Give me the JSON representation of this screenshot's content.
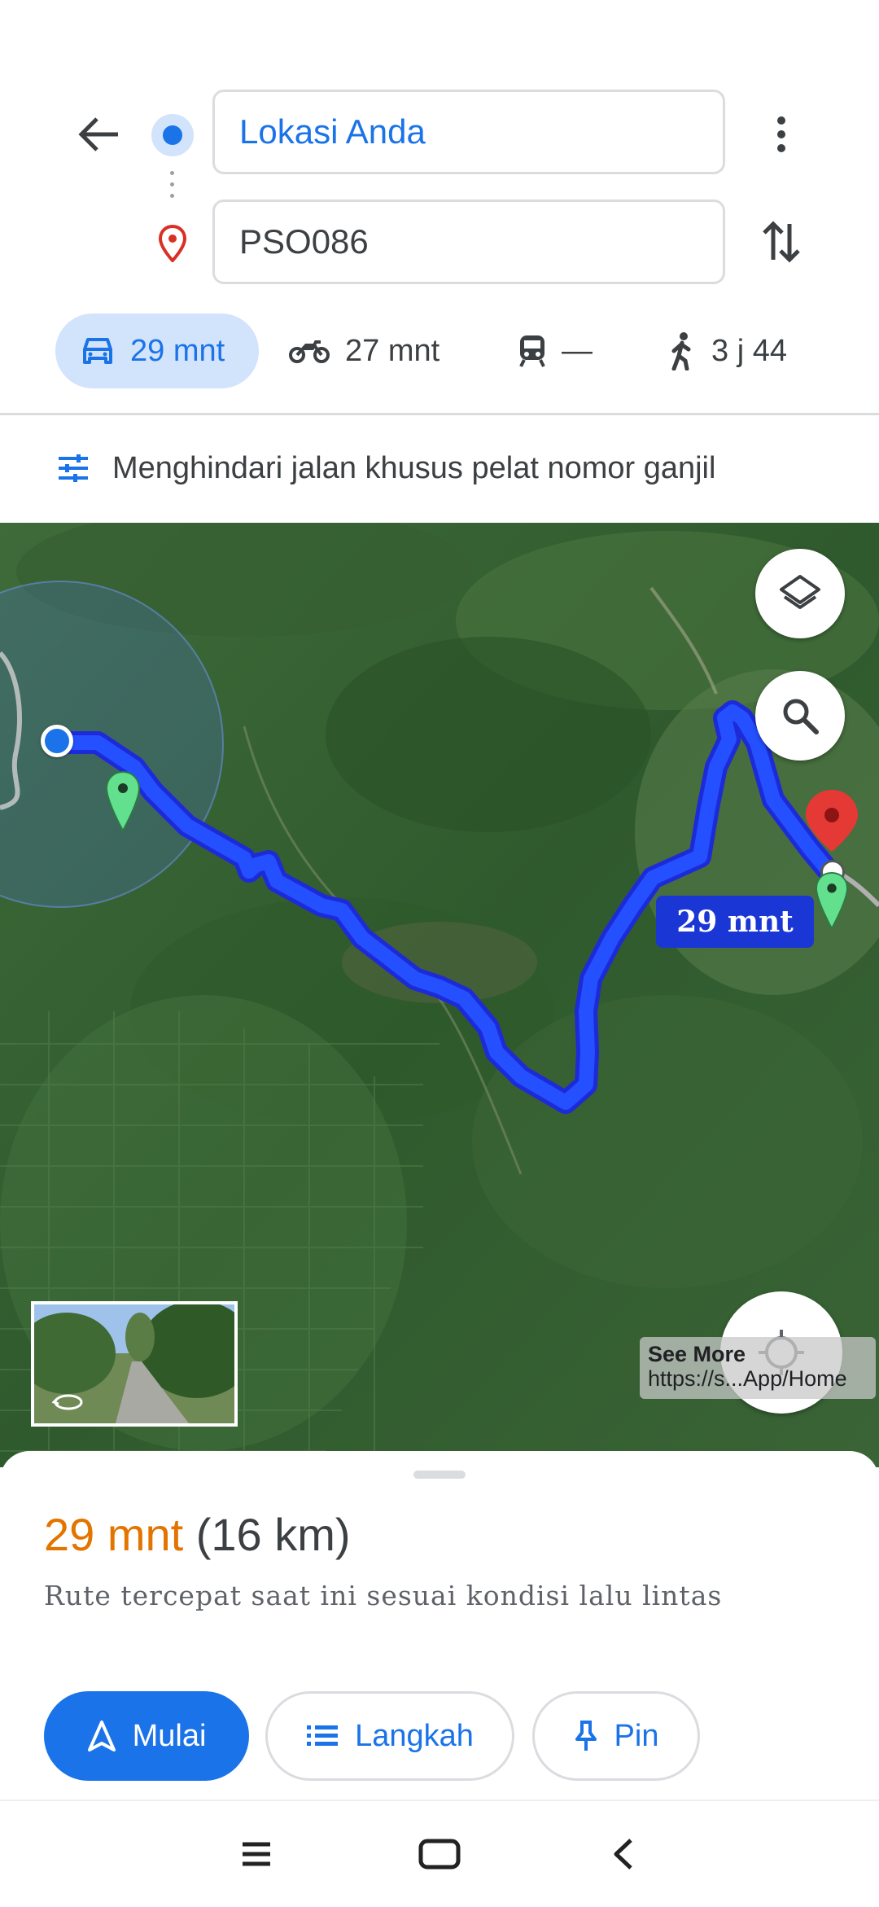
{
  "directions": {
    "origin_value": "Lokasi Anda",
    "destination_value": "PSO086"
  },
  "modes": [
    {
      "name": "car",
      "time": "29 mnt",
      "selected": true
    },
    {
      "name": "motorcycle",
      "time": "27 mnt"
    },
    {
      "name": "transit",
      "time": "—"
    },
    {
      "name": "walk",
      "time": "3 j 44"
    }
  ],
  "options": {
    "avoid_text": "Menghindari jalan khusus pelat nomor ganjil"
  },
  "map": {
    "route_eta": "29 mnt",
    "attribution_title": "See More",
    "attribution_url": "https://s...App/Home"
  },
  "sheet": {
    "duration": "29 mnt",
    "distance": "(16 km)",
    "description": "Rute tercepat saat ini sesuai kondisi lalu lintas",
    "start_label": "Mulai",
    "steps_label": "Langkah",
    "pin_label": "Pin"
  },
  "colors": {
    "accent": "#1a73e8",
    "route": "#1a3cff",
    "duration": "#e37400",
    "destination_pin": "#e53935",
    "waypoint_pin": "#5ee38a"
  }
}
